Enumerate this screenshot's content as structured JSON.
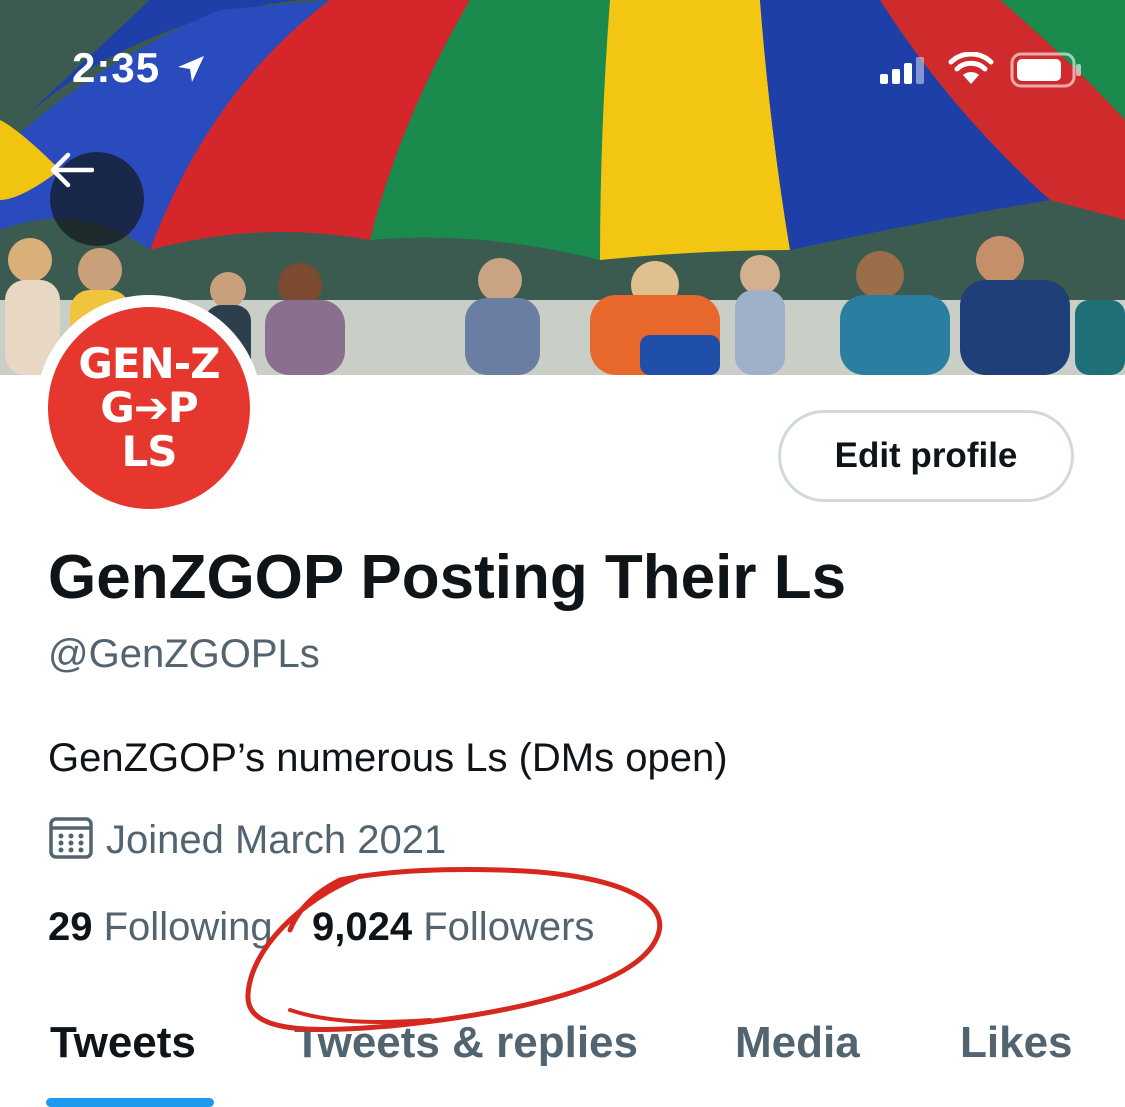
{
  "status_bar": {
    "time": "2:35",
    "location_icon": "location-arrow-icon",
    "signal_icon": "cellular-signal-icon",
    "wifi_icon": "wifi-icon",
    "battery_icon": "battery-icon"
  },
  "header": {
    "back_icon": "arrow-left-icon",
    "banner": "parachute-photo"
  },
  "profile": {
    "avatar_lines": [
      "GEN-Z",
      "G➔P",
      "LS"
    ],
    "avatar_color": "#e6372f",
    "edit_button": "Edit profile",
    "display_name": "GenZGOP Posting Their Ls",
    "handle": "@GenZGOPLs",
    "bio": "GenZGOP’s numerous Ls (DMs open)",
    "joined_icon": "calendar-icon",
    "joined": "Joined March 2021",
    "following_count": "29",
    "following_label": "Following",
    "followers_count": "9,024",
    "followers_label": "Followers"
  },
  "tabs": [
    {
      "label": "Tweets",
      "active": true
    },
    {
      "label": "Tweets & replies",
      "active": false
    },
    {
      "label": "Media",
      "active": false
    },
    {
      "label": "Likes",
      "active": false
    }
  ],
  "colors": {
    "accent": "#1d9bf0",
    "text_primary": "#0f1419",
    "text_secondary": "#536471",
    "annotation": "#d7281f"
  }
}
